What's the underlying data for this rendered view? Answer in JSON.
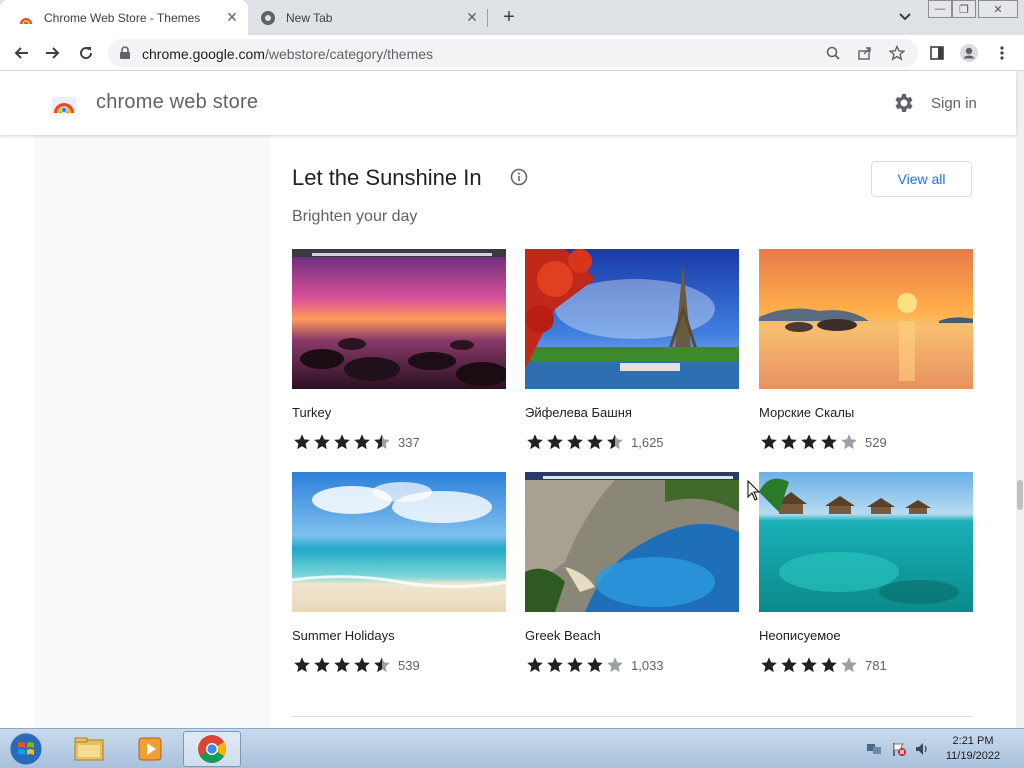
{
  "browser": {
    "tabs": [
      {
        "title": "Chrome Web Store - Themes",
        "active": true
      },
      {
        "title": "New Tab",
        "active": false
      }
    ],
    "address": {
      "host": "chrome.google.com",
      "path": "/webstore/category/themes"
    }
  },
  "store": {
    "name": "chrome web store",
    "sign_in": "Sign in"
  },
  "section": {
    "title": "Let the Sunshine In",
    "subtitle": "Brighten your day",
    "view_all": "View all"
  },
  "themes": [
    {
      "name": "Turkey",
      "rating": 4.5,
      "count": "337"
    },
    {
      "name": "Эйфелева Башня",
      "rating": 4.5,
      "count": "1,625"
    },
    {
      "name": "Морские Скалы",
      "rating": 4,
      "count": "529"
    },
    {
      "name": "Summer Holidays",
      "rating": 4.5,
      "count": "539"
    },
    {
      "name": "Greek Beach",
      "rating": 4,
      "count": "1,033"
    },
    {
      "name": "Неописуемое",
      "rating": 4,
      "count": "781"
    }
  ],
  "taskbar": {
    "time": "2:21 PM",
    "date": "11/19/2022"
  },
  "colors": {
    "accent": "#1a73e8",
    "star": "#202124",
    "star_empty": "#9aa0a6"
  }
}
